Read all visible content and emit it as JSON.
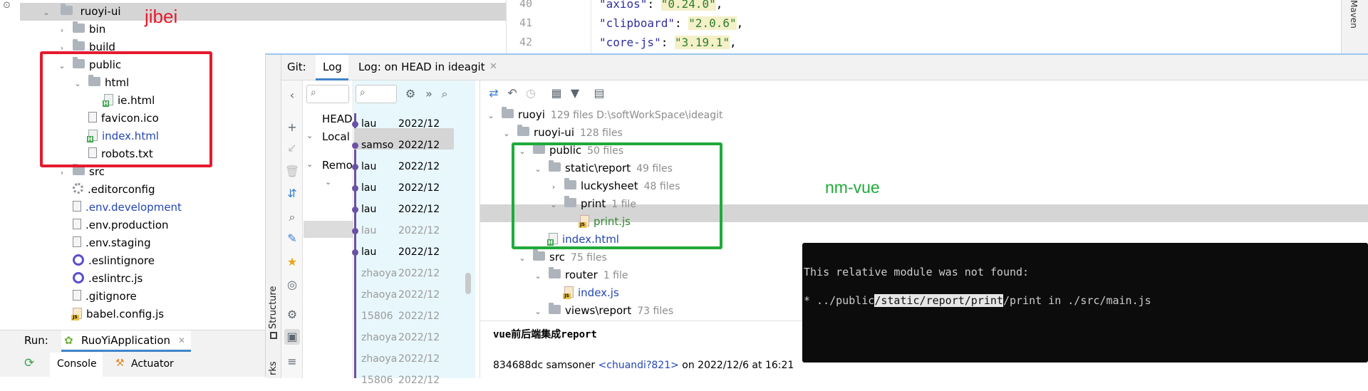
{
  "project": {
    "root": "ruoyi-ui",
    "items": [
      {
        "label": "bin",
        "type": "folder",
        "depth": 1,
        "chevron": "›"
      },
      {
        "label": "build",
        "type": "folder",
        "depth": 1,
        "chevron": "›"
      },
      {
        "label": "public",
        "type": "folder",
        "depth": 1,
        "chevron": "⌄"
      },
      {
        "label": "html",
        "type": "folder",
        "depth": 2,
        "chevron": "⌄"
      },
      {
        "label": "ie.html",
        "type": "html",
        "depth": 3
      },
      {
        "label": "favicon.ico",
        "type": "file",
        "depth": 2
      },
      {
        "label": "index.html",
        "type": "html",
        "depth": 2,
        "color": "#2346b3"
      },
      {
        "label": "robots.txt",
        "type": "file",
        "depth": 2
      },
      {
        "label": "src",
        "type": "folder",
        "depth": 1,
        "chevron": "›"
      },
      {
        "label": ".editorconfig",
        "type": "gear",
        "depth": 1
      },
      {
        "label": ".env.development",
        "type": "file",
        "depth": 1,
        "color": "#2346b3"
      },
      {
        "label": ".env.production",
        "type": "file",
        "depth": 1
      },
      {
        "label": ".env.staging",
        "type": "file",
        "depth": 1
      },
      {
        "label": ".eslintignore",
        "type": "ring",
        "depth": 1
      },
      {
        "label": ".eslintrc.js",
        "type": "ring",
        "depth": 1
      },
      {
        "label": ".gitignore",
        "type": "file",
        "depth": 1
      },
      {
        "label": "babel.config.js",
        "type": "js",
        "depth": 1
      }
    ]
  },
  "annotations": {
    "left": "jibei",
    "right": "nm-vue"
  },
  "editor": {
    "lines": [
      {
        "num": "40",
        "key": "\"axios\"",
        "val": "\"0.24.0\""
      },
      {
        "num": "41",
        "key": "\"clipboard\"",
        "val": "\"2.0.6\""
      },
      {
        "num": "42",
        "key": "\"core-js\"",
        "val": "\"3.19.1\""
      }
    ],
    "right_tab": "Maven"
  },
  "git": {
    "label": "Git:",
    "tabs": [
      "Log",
      "Log: on HEAD in ideagit"
    ],
    "branches": [
      "HEAD",
      "Local",
      "Remo"
    ],
    "commits": [
      {
        "author": "lau",
        "date": "2022/12"
      },
      {
        "author": "samso",
        "date": "2022/12"
      },
      {
        "author": "lau",
        "date": "2022/12"
      },
      {
        "author": "lau",
        "date": "2022/12"
      },
      {
        "author": "lau",
        "date": "2022/12"
      },
      {
        "author": "lau",
        "date": "2022/12"
      },
      {
        "author": "lau",
        "date": "2022/12"
      },
      {
        "author": "zhaoya",
        "date": "2022/12"
      },
      {
        "author": "zhaoya",
        "date": "2022/12"
      },
      {
        "author": "15806",
        "date": "2022/12"
      },
      {
        "author": "zhaoya",
        "date": "2022/12"
      },
      {
        "author": "zhaoya",
        "date": "2022/12"
      },
      {
        "author": "15806",
        "date": "2022/12"
      }
    ],
    "changes": [
      {
        "label": "ruoyi",
        "meta": "129 files  D:\\softWorkSpace\\ideagit",
        "depth": 0,
        "chevron": "⌄",
        "type": "folder"
      },
      {
        "label": "ruoyi-ui",
        "meta": "128 files",
        "depth": 1,
        "chevron": "⌄",
        "type": "folder"
      },
      {
        "label": "public",
        "meta": "50 files",
        "depth": 2,
        "chevron": "⌄",
        "type": "folder"
      },
      {
        "label": "static\\report",
        "meta": "49 files",
        "depth": 3,
        "chevron": "⌄",
        "type": "folder"
      },
      {
        "label": "luckysheet",
        "meta": "48 files",
        "depth": 4,
        "chevron": "›",
        "type": "folder"
      },
      {
        "label": "print",
        "meta": "1 file",
        "depth": 4,
        "chevron": "⌄",
        "type": "folder"
      },
      {
        "label": "print.js",
        "meta": "",
        "depth": 5,
        "type": "js"
      },
      {
        "label": "index.html",
        "meta": "",
        "depth": 3,
        "type": "html"
      },
      {
        "label": "src",
        "meta": "75 files",
        "depth": 2,
        "chevron": "⌄",
        "type": "folder"
      },
      {
        "label": "router",
        "meta": "1 file",
        "depth": 3,
        "chevron": "⌄",
        "type": "folder"
      },
      {
        "label": "index.js",
        "meta": "",
        "depth": 4,
        "type": "js"
      },
      {
        "label": "views\\report",
        "meta": "73 files",
        "depth": 3,
        "chevron": "⌄",
        "type": "folder"
      }
    ],
    "commit_message": "vue前后端集成report",
    "commit_hash": "834688dc samsoner",
    "commit_email": "<chuandi?821>",
    "commit_date": "on 2022/12/6 at 16:21"
  },
  "terminal": {
    "line1": "This relative module was not found:",
    "line2_prefix": "* ../public",
    "line2_highlight": "/static/report/print",
    "line2_suffix": "/print in ./src/main.js"
  },
  "run": {
    "label": "Run:",
    "app": "RuoYiApplication",
    "tabs": [
      "Console",
      "Actuator"
    ]
  },
  "side_tabs": {
    "structure": "Structure",
    "bookmarks": "rks"
  },
  "colors": {
    "red_box": "#e51a2e",
    "green_box": "#1faa3a",
    "annotation_red": "#e51a2e",
    "annotation_green": "#1faa3a",
    "selection": "#d5d5d5",
    "terminal_bg": "#0c0c0c",
    "commit_bg": "#e8f7fb"
  }
}
